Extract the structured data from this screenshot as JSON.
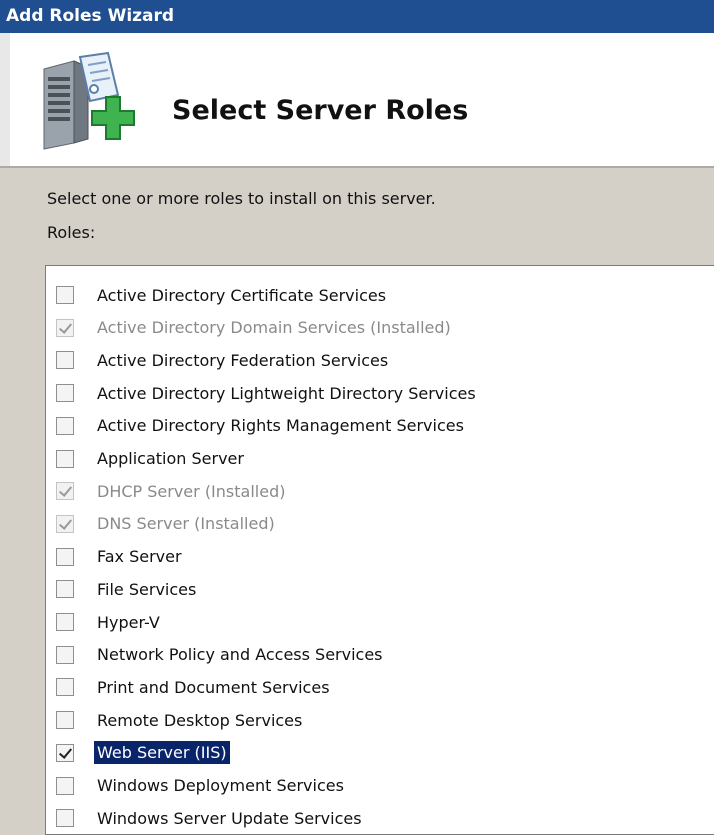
{
  "window": {
    "title": "Add Roles Wizard"
  },
  "header": {
    "title": "Select Server Roles",
    "icon": "server-add-icon"
  },
  "content": {
    "instruction": "Select one or more roles to install on this server.",
    "roles_label": "Roles:"
  },
  "colors": {
    "title_bar": "#1f4e91",
    "selection": "#0a246a",
    "dialog_bg": "#d4d0c8",
    "disabled_text": "#8a8a8a"
  },
  "roles": [
    {
      "label": "Active Directory Certificate Services",
      "checked": false,
      "installed": false,
      "selected": false
    },
    {
      "label": "Active Directory Domain Services",
      "suffix": "(Installed)",
      "checked": true,
      "installed": true,
      "selected": false
    },
    {
      "label": "Active Directory Federation Services",
      "checked": false,
      "installed": false,
      "selected": false
    },
    {
      "label": "Active Directory Lightweight Directory Services",
      "checked": false,
      "installed": false,
      "selected": false
    },
    {
      "label": "Active Directory Rights Management Services",
      "checked": false,
      "installed": false,
      "selected": false
    },
    {
      "label": "Application Server",
      "checked": false,
      "installed": false,
      "selected": false
    },
    {
      "label": "DHCP Server",
      "suffix": "(Installed)",
      "checked": true,
      "installed": true,
      "selected": false
    },
    {
      "label": "DNS Server",
      "suffix": "(Installed)",
      "checked": true,
      "installed": true,
      "selected": false
    },
    {
      "label": "Fax Server",
      "checked": false,
      "installed": false,
      "selected": false
    },
    {
      "label": "File Services",
      "checked": false,
      "installed": false,
      "selected": false
    },
    {
      "label": "Hyper-V",
      "checked": false,
      "installed": false,
      "selected": false
    },
    {
      "label": "Network Policy and Access Services",
      "checked": false,
      "installed": false,
      "selected": false
    },
    {
      "label": "Print and Document Services",
      "checked": false,
      "installed": false,
      "selected": false
    },
    {
      "label": "Remote Desktop Services",
      "checked": false,
      "installed": false,
      "selected": false
    },
    {
      "label": "Web Server (IIS)",
      "checked": true,
      "installed": false,
      "selected": true
    },
    {
      "label": "Windows Deployment Services",
      "checked": false,
      "installed": false,
      "selected": false
    },
    {
      "label": "Windows Server Update Services",
      "checked": false,
      "installed": false,
      "selected": false
    }
  ]
}
